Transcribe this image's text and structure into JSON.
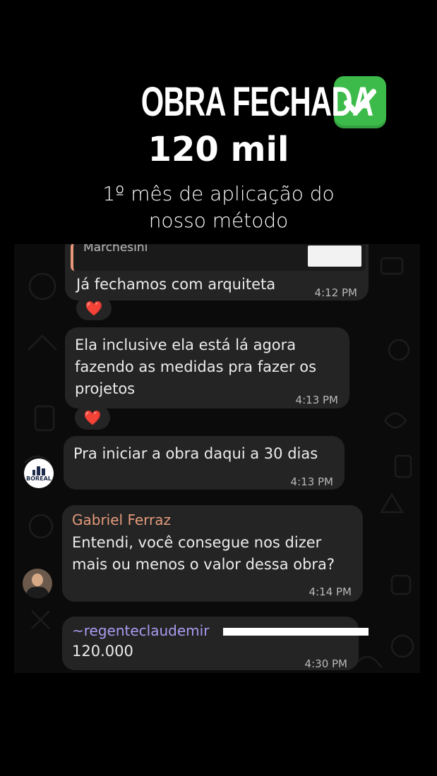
{
  "header": {
    "title": "OBRA FECHADA",
    "title_icon": "check-mark-button-emoji",
    "amount": "120 mil",
    "subtitle_line1": "1º mês de aplicação do",
    "subtitle_line2": "nosso método"
  },
  "chat": {
    "background": "#0b0b0b",
    "bubble_color": "#242424",
    "quoted_preview": "Marchesini",
    "messages": [
      {
        "text": "Já fechamos com arquiteta",
        "time": "4:12 PM",
        "reaction": "❤️"
      },
      {
        "lines": [
          "Ela inclusive ela está lá agora",
          "fazendo as medidas pra fazer os",
          "projetos"
        ],
        "time": "4:13 PM",
        "reaction": "❤️"
      },
      {
        "text": "Pra iniciar a obra daqui a 30 dias",
        "time": "4:13 PM",
        "avatar_text": "BOREAL"
      },
      {
        "sender": "Gabriel Ferraz",
        "sender_color": "#e39b7b",
        "lines": [
          "Entendi, você consegue nos dizer",
          "mais ou menos o valor dessa obra?"
        ],
        "time": "4:14 PM"
      },
      {
        "sender": "~regenteclaudemir",
        "sender_color": "#a99bf0",
        "text": "120.000",
        "time": "4:30 PM"
      }
    ]
  }
}
